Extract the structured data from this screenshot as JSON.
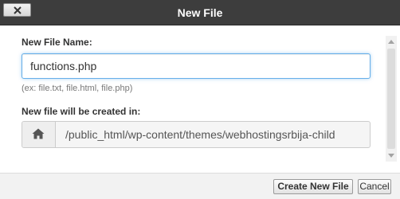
{
  "dialog": {
    "title": "New File",
    "close_icon": "close-icon"
  },
  "form": {
    "file_name_label": "New File Name:",
    "file_name_value": "functions.php",
    "file_name_hint": "(ex: file.txt, file.html, file.php)",
    "directory_label": "New file will be created in:",
    "directory_value": "/public_html/wp-content/themes/webhostingsrbija-child",
    "directory_icon": "home-icon"
  },
  "footer": {
    "create_label": "Create New File",
    "cancel_label": "Cancel"
  },
  "colors": {
    "titlebar": "#3d3d3d",
    "focus_border": "#66afe9"
  }
}
